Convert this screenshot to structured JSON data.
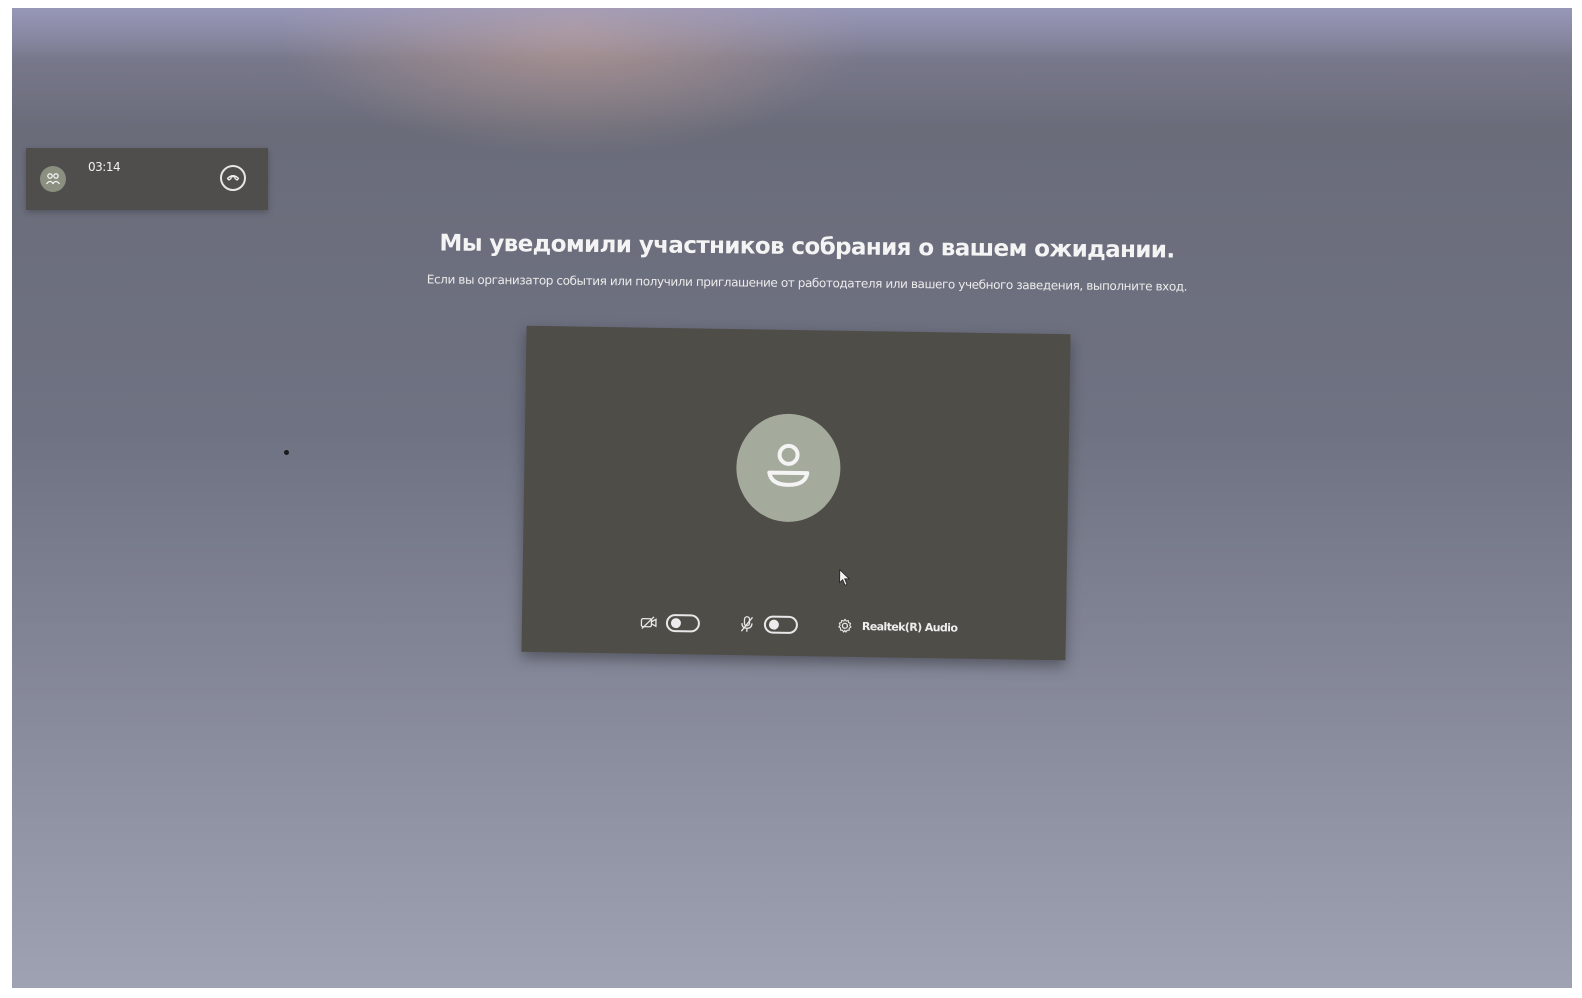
{
  "call_bar": {
    "timer": "03:14",
    "participants_icon": "people-icon",
    "hangup_icon": "hang-up-icon"
  },
  "lobby": {
    "title": "Мы уведомили участников собрания о вашем ожидании.",
    "subtitle": "Если вы организатор события или получили приглашение от работодателя или вашего учебного заведения, выполните вход."
  },
  "preview": {
    "avatar_icon": "person-icon",
    "camera_toggle": {
      "icon": "camera-off-icon",
      "on": false
    },
    "mic_toggle": {
      "icon": "mic-off-icon",
      "on": false
    },
    "audio_device": {
      "icon": "gear-icon",
      "label": "Realtek(R) Audio"
    }
  },
  "colors": {
    "panel_bg": "#4e4d48",
    "avatar_bg": "#a4ab9c",
    "text": "#f4f4f4"
  }
}
